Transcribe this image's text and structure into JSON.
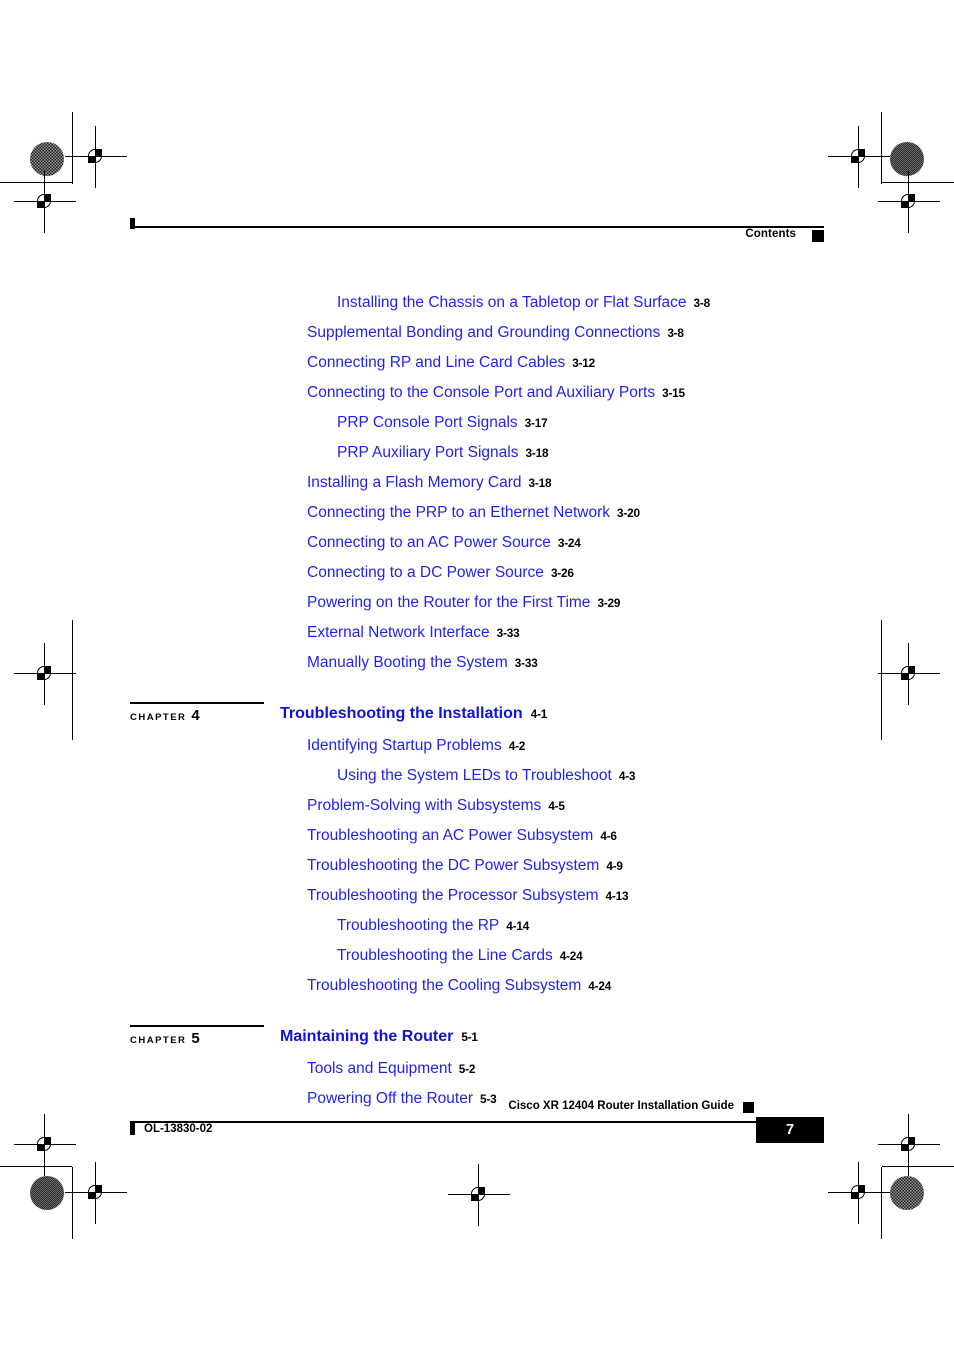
{
  "header": {
    "label": "Contents"
  },
  "toc": {
    "pre_entries": [
      {
        "level": 2,
        "title": "Installing the Chassis on a Tabletop or Flat Surface",
        "page": "3-8"
      },
      {
        "level": 1,
        "title": "Supplemental Bonding and Grounding Connections",
        "page": "3-8"
      },
      {
        "level": 1,
        "title": "Connecting RP and Line Card Cables",
        "page": "3-12"
      },
      {
        "level": 1,
        "title": "Connecting to the Console Port and Auxiliary Ports",
        "page": "3-15"
      },
      {
        "level": 2,
        "title": "PRP Console Port Signals",
        "page": "3-17"
      },
      {
        "level": 2,
        "title": "PRP Auxiliary Port Signals",
        "page": "3-18"
      },
      {
        "level": 1,
        "title": "Installing a Flash Memory Card",
        "page": "3-18"
      },
      {
        "level": 1,
        "title": "Connecting the PRP to an Ethernet Network",
        "page": "3-20"
      },
      {
        "level": 1,
        "title": "Connecting to an AC Power Source",
        "page": "3-24"
      },
      {
        "level": 1,
        "title": "Connecting to a DC Power Source",
        "page": "3-26"
      },
      {
        "level": 1,
        "title": "Powering on the Router for the First Time",
        "page": "3-29"
      },
      {
        "level": 1,
        "title": "External Network Interface",
        "page": "3-33"
      },
      {
        "level": 1,
        "title": "Manually Booting the System",
        "page": "3-33"
      }
    ],
    "chapters": [
      {
        "tag_label": "CHAPTER",
        "number": "4",
        "title": "Troubleshooting the Installation",
        "page": "4-1",
        "entries": [
          {
            "level": 1,
            "title": "Identifying Startup Problems",
            "page": "4-2"
          },
          {
            "level": 2,
            "title": "Using the System LEDs to Troubleshoot",
            "page": "4-3"
          },
          {
            "level": 1,
            "title": "Problem-Solving with Subsystems",
            "page": "4-5"
          },
          {
            "level": 1,
            "title": "Troubleshooting an AC Power Subsystem",
            "page": "4-6"
          },
          {
            "level": 1,
            "title": "Troubleshooting the DC Power Subsystem",
            "page": "4-9"
          },
          {
            "level": 1,
            "title": "Troubleshooting the Processor Subsystem",
            "page": "4-13"
          },
          {
            "level": 2,
            "title": "Troubleshooting the RP",
            "page": "4-14"
          },
          {
            "level": 2,
            "title": "Troubleshooting the Line Cards",
            "page": "4-24"
          },
          {
            "level": 1,
            "title": "Troubleshooting the Cooling Subsystem",
            "page": "4-24"
          }
        ]
      },
      {
        "tag_label": "CHAPTER",
        "number": "5",
        "title": "Maintaining the Router",
        "page": "5-1",
        "entries": [
          {
            "level": 1,
            "title": "Tools and Equipment",
            "page": "5-2"
          },
          {
            "level": 1,
            "title": "Powering Off the Router",
            "page": "5-3"
          }
        ]
      }
    ]
  },
  "footer": {
    "guide_title": "Cisco XR 12404 Router Installation Guide",
    "doc_id": "OL-13830-02",
    "page_number": "7"
  },
  "colors": {
    "link_blue": "#2222ee",
    "heading_blue": "#1111dd",
    "black": "#000000"
  }
}
